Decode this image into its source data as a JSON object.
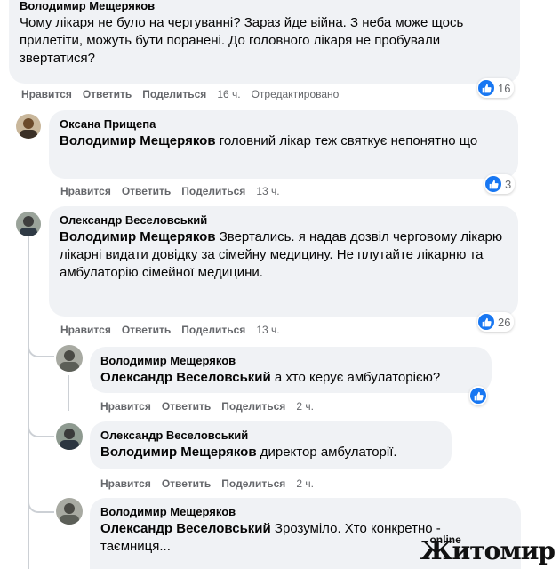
{
  "comments": [
    {
      "author": "Володимир Мещеряков",
      "mention": "",
      "text": "Чому лікаря не було на чергуванні? Зараз йде війна. З неба може щось прилетіти, можуть бути поранені. До головного лікаря не пробували звертатися?",
      "like": "Нравится",
      "reply": "Ответить",
      "share": "Поделиться",
      "time": "16 ч.",
      "edited": "Отредактировано",
      "reactions": "16"
    },
    {
      "author": "Оксана Прищепа",
      "mention": "Володимир Мещеряков",
      "text": " головний лікар теж святкує непонятно що",
      "like": "Нравится",
      "reply": "Ответить",
      "share": "Поделиться",
      "time": "13 ч.",
      "reactions": "3"
    },
    {
      "author": "Олександр Веселовський",
      "mention": "Володимир Мещеряков",
      "text": " Звертались. я надав дозвіл черговому лікарю лікарні видати довідку за сімейну медицину. Не плутайте лікарню та амбулаторію сімейної медицини.",
      "like": "Нравится",
      "reply": "Ответить",
      "share": "Поделиться",
      "time": "13 ч.",
      "reactions": "26"
    },
    {
      "author": "Володимир Мещеряков",
      "mention": "Олександр Веселовський",
      "text": " а хто керує амбулаторією?",
      "like": "Нравится",
      "reply": "Ответить",
      "share": "Поделиться",
      "time": "2 ч."
    },
    {
      "author": "Олександр Веселовський",
      "mention": "Володимир Мещеряков",
      "text": " директор амбулаторії.",
      "like": "Нравится",
      "reply": "Ответить",
      "share": "Поделиться",
      "time": "2 ч."
    },
    {
      "author": "Володимир Мещеряков",
      "mention": "Олександр Веселовський",
      "text": " Зрозуміло. Хто конкретно - таємниця..."
    }
  ],
  "watermark": {
    "online": "online",
    "city": "Житомир"
  },
  "colors": {
    "bubble": "#f0f2f5",
    "like_blue": "#1877f2",
    "meta_gray": "#65676b"
  }
}
